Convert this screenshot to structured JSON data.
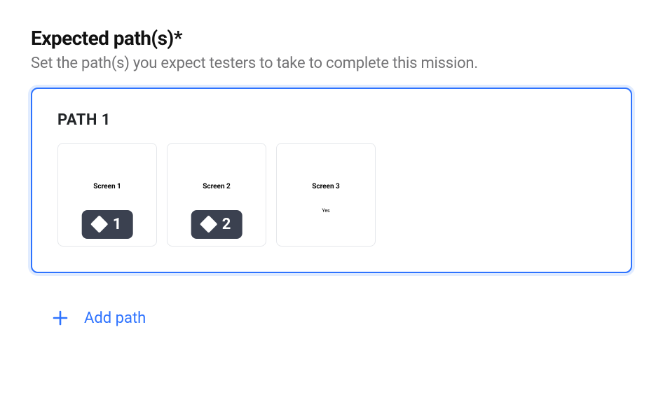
{
  "section": {
    "title": "Expected path(s)*",
    "subtitle": "Set the path(s) you expect testers to take to complete this mission."
  },
  "path": {
    "title": "PATH 1",
    "screens": [
      {
        "label": "Screen 1",
        "badge": "1",
        "sub": ""
      },
      {
        "label": "Screen 2",
        "badge": "2",
        "sub": ""
      },
      {
        "label": "Screen 3",
        "badge": "",
        "sub": "Yes"
      }
    ]
  },
  "add_path": {
    "label": "Add path"
  },
  "colors": {
    "accent": "#2e73ff",
    "badge_bg": "#3b4150"
  }
}
